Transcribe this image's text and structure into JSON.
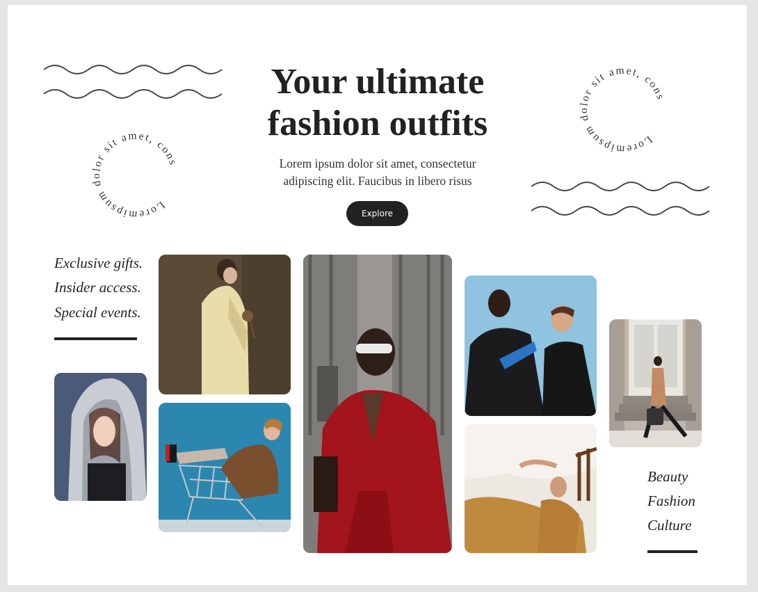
{
  "hero": {
    "title_line1": "Your ultimate",
    "title_line2": "fashion outfits",
    "subtitle_line1": "Lorem ipsum dolor sit amet, consectetur",
    "subtitle_line2": "adipiscing elit. Faucibus in libero risus",
    "cta_label": "Explore"
  },
  "badge_text": "Loremipsum dolor sit amet, cons",
  "left_taglines": [
    "Exclusive gifts.",
    "Insider access.",
    "Special events."
  ],
  "right_taglines": [
    "Beauty",
    "Fashion",
    "Culture"
  ],
  "colors": {
    "background": "#e5e5e5",
    "page": "#ffffff",
    "text": "#222222",
    "button": "#222222"
  }
}
